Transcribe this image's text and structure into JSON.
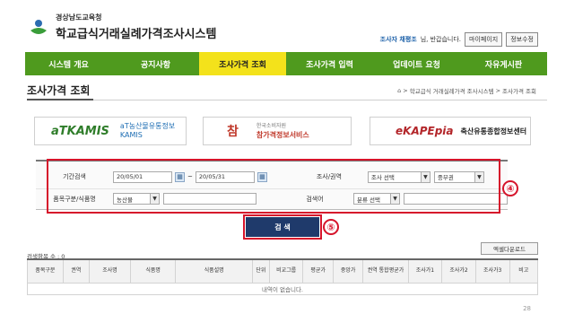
{
  "header": {
    "org_name": "경상남도교육청",
    "system_name": "학교급식거래실례가격조사시스템",
    "user_name": "조사자 채평조",
    "greeting": "님, 반갑습니다.",
    "mypage_label": "마이페이지",
    "edit_info_label": "정보수정"
  },
  "nav": {
    "items": [
      {
        "label": "시스템 개요"
      },
      {
        "label": "공지사항"
      },
      {
        "label": "조사가격 조회"
      },
      {
        "label": "조사가격 입력"
      },
      {
        "label": "업데이트 요청"
      },
      {
        "label": "자유게시판"
      }
    ],
    "active_index": 2,
    "colors": {
      "bar": "#4f9a1e",
      "active": "#f3e21b"
    }
  },
  "page": {
    "title": "조사가격 조회",
    "breadcrumb": [
      "학교급식 거래실례가격 조사시스템",
      "조사가격 조회"
    ],
    "page_number": "28"
  },
  "banners": [
    {
      "mark": "aTKAMIS",
      "text_line1": "aT농산물유통정보",
      "text_line2": "KAMIS"
    },
    {
      "mark": "참",
      "small": "한국소비자원",
      "text": "참가격정보서비스"
    },
    {
      "mark": "eKAPEpia",
      "text": "축산유통종합정보센터"
    }
  ],
  "search": {
    "period_label": "기간검색",
    "date_from": "20/05/01",
    "date_to": "20/05/31",
    "tilde": "~",
    "region_label": "조사/권역",
    "region_select1": "조사 선택",
    "region_select2": "중부권",
    "category_label": "품목구분/식품명",
    "category_select": "농산물",
    "keyword_label": "검색어",
    "keyword_select": "분류 선택",
    "button_label": "검 색",
    "annotation_4": "④",
    "annotation_5": "⑤",
    "highlight_color": "#d6142b"
  },
  "results": {
    "count_text": "검색항목 수 : 0",
    "excel_label": "엑셀다운로드",
    "columns": [
      "품목구분",
      "권역",
      "조사명",
      "식품명",
      "식품설명",
      "단위",
      "비교그룹",
      "평균가",
      "중앙가",
      "권역 통합평균가",
      "조사가1",
      "조사가2",
      "조사가3",
      "비고"
    ],
    "empty_message": "내역이 없습니다."
  }
}
